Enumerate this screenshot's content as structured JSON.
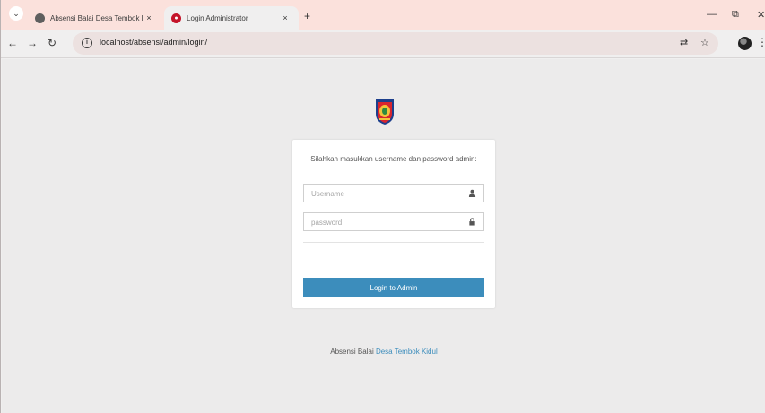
{
  "browser": {
    "tabs": [
      {
        "title": "Absensi Balai Desa Tembok Kid",
        "close": "×"
      },
      {
        "title": "Login Administrator",
        "close": "×"
      }
    ],
    "new_tab": "+",
    "url": "localhost/absensi/admin/login/",
    "controls": {
      "minimize": "—",
      "restore": "⧉",
      "close": "✕"
    }
  },
  "login": {
    "message": "Silahkan masukkan username dan password admin:",
    "username_placeholder": "Username",
    "password_placeholder": "password",
    "button_label": "Login to Admin"
  },
  "footer": {
    "prefix": "Absensi Balai ",
    "link": "Desa Tembok Kidul"
  },
  "colors": {
    "accent": "#3c8dbc",
    "tabstrip": "#fbe1dc",
    "page_background": "#ecebeb"
  },
  "icons": [
    "chevron-down-icon",
    "globe-icon",
    "close-icon",
    "plus-icon",
    "back-icon",
    "forward-icon",
    "reload-icon",
    "info-icon",
    "translate-icon",
    "star-icon",
    "profile-icon",
    "menu-icon",
    "user-icon",
    "lock-icon",
    "emblem-logo"
  ]
}
